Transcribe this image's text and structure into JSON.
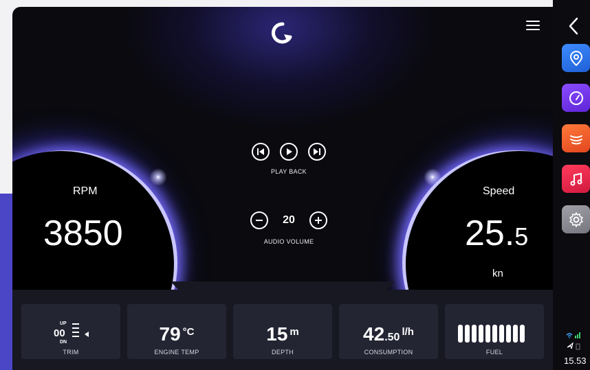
{
  "dashboard": {
    "logo_name": "brand-logo",
    "rpm": {
      "label": "RPM",
      "value": "3850"
    },
    "speed": {
      "label": "Speed",
      "value_int": "25.",
      "value_dec": "5",
      "unit": "kn"
    },
    "media": {
      "label": "PLAY BACK"
    },
    "volume": {
      "label": "AUDIO VOLUME",
      "value": "20"
    },
    "cards": {
      "trim": {
        "up": "UP",
        "value": "00",
        "dn": "DN",
        "label": "TRIM"
      },
      "engine_temp": {
        "value": "79",
        "unit": "°C",
        "label": "ENGINE TEMP"
      },
      "depth": {
        "value": "15",
        "unit": "m",
        "label": "DEPTH"
      },
      "consumption": {
        "value": "42",
        "dec": ".50",
        "unit": "l/h",
        "label": "CONSUMPTION"
      },
      "fuel": {
        "label": "FUEL",
        "bars_filled": 10,
        "bars_total": 10
      }
    }
  },
  "rail": {
    "apps": [
      {
        "name": "location-pin-icon",
        "color": "#2e7cf6"
      },
      {
        "name": "speedometer-icon",
        "color": "#7a3cf0"
      },
      {
        "name": "waves-icon",
        "color": "#f05a2a"
      },
      {
        "name": "music-note-icon",
        "color": "#e8264f"
      },
      {
        "name": "gear-icon",
        "color": "#8e8e96"
      }
    ],
    "clock": "15.53"
  },
  "colors": {
    "accent": "#4b46c6",
    "glow": "#6a5cff",
    "card_bg": "#242533",
    "bar_bg": "#171821"
  }
}
